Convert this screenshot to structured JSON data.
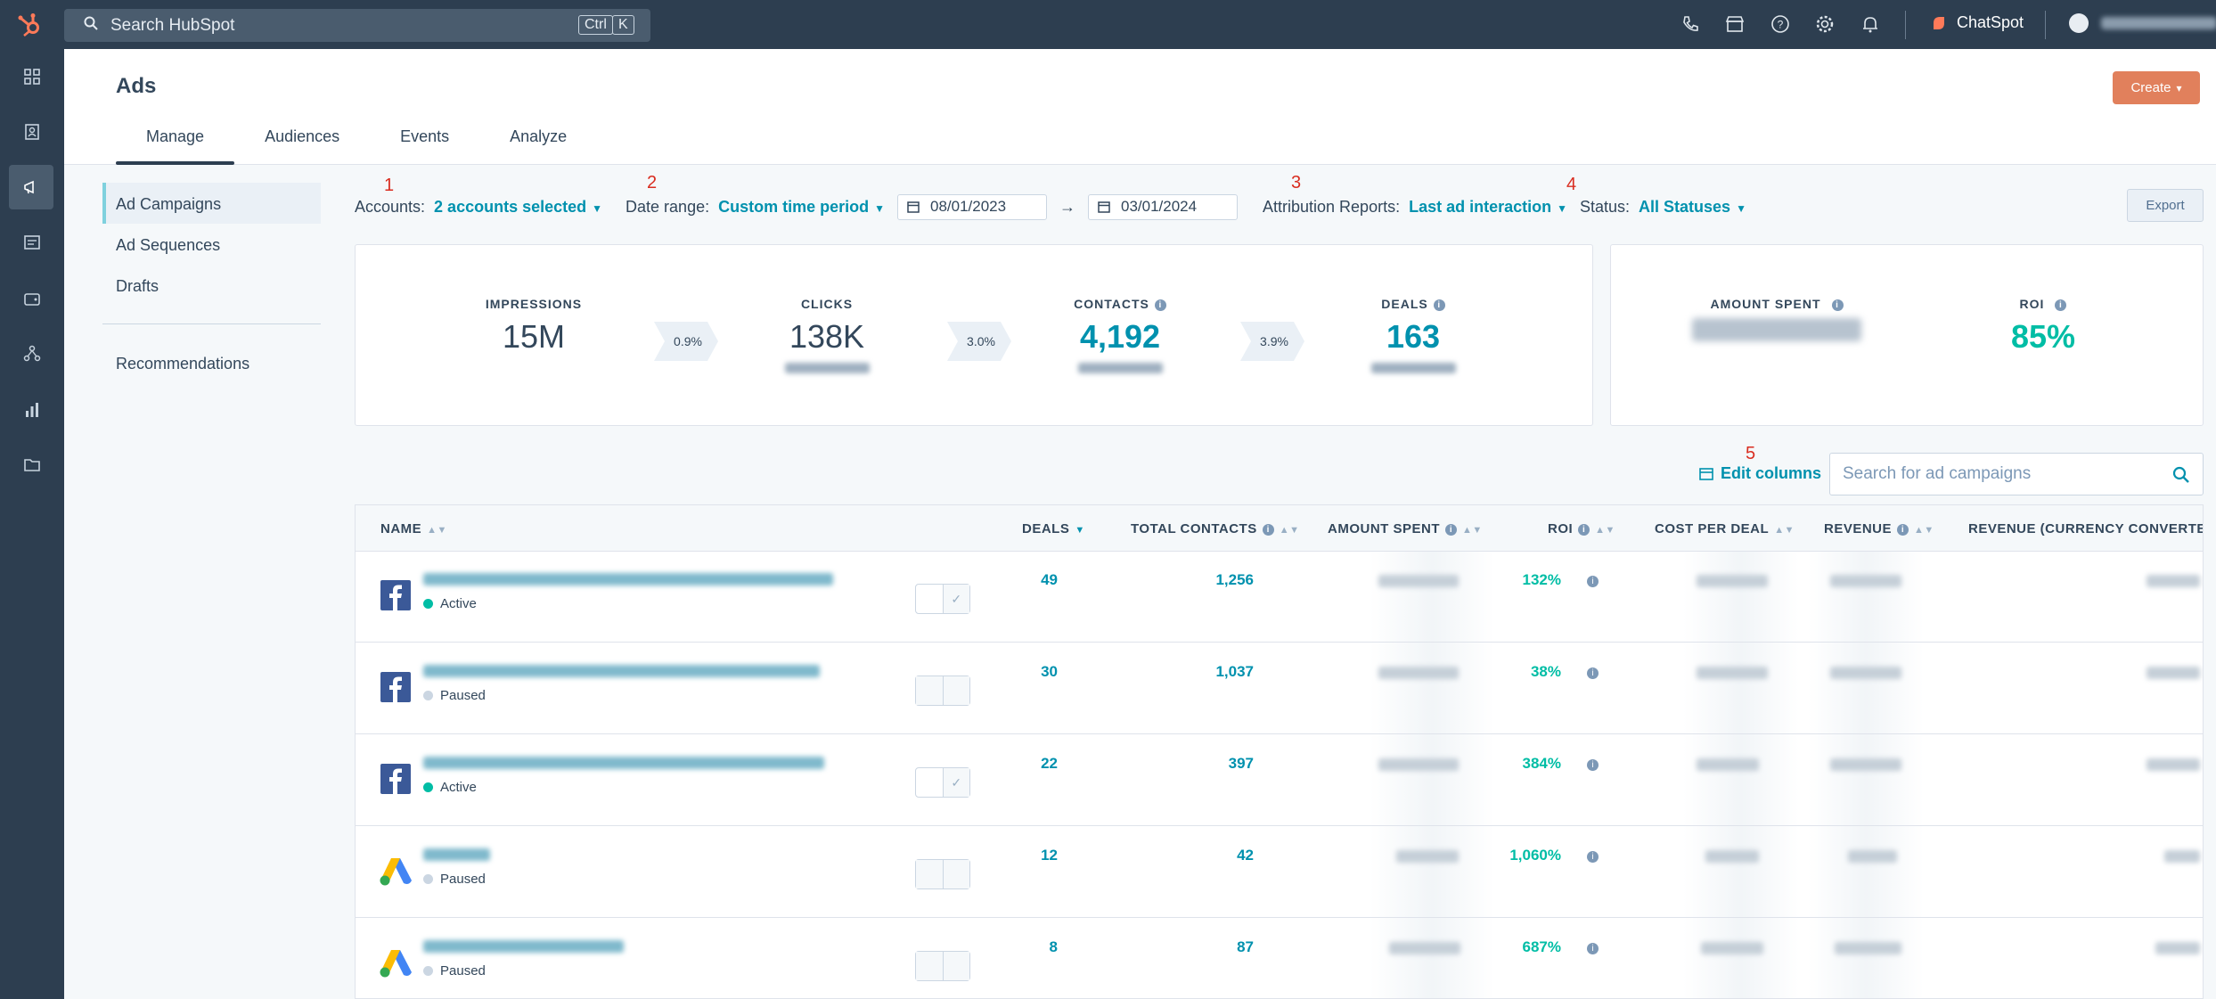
{
  "topbar": {
    "search_placeholder": "Search HubSpot",
    "kbd_ctrl": "Ctrl",
    "kbd_k": "K",
    "chatspot_label": "ChatSpot"
  },
  "header": {
    "title": "Ads",
    "create_label": "Create",
    "tabs": [
      {
        "label": "Manage"
      },
      {
        "label": "Audiences"
      },
      {
        "label": "Events"
      },
      {
        "label": "Analyze"
      }
    ]
  },
  "leftnav": {
    "items": [
      {
        "label": "Ad Campaigns"
      },
      {
        "label": "Ad Sequences"
      },
      {
        "label": "Drafts"
      },
      {
        "label": "Recommendations"
      }
    ]
  },
  "annotations": [
    "1",
    "2",
    "3",
    "4",
    "5"
  ],
  "filters": {
    "accounts_label": "Accounts:",
    "accounts_value": "2 accounts selected",
    "date_label": "Date range:",
    "date_value": "Custom time period",
    "start_date": "08/01/2023",
    "end_date": "03/01/2024",
    "attribution_label": "Attribution Reports:",
    "attribution_value": "Last ad interaction",
    "status_label": "Status:",
    "status_value": "All Statuses",
    "export_label": "Export"
  },
  "metrics": {
    "impressions": {
      "label": "IMPRESSIONS",
      "value": "15M"
    },
    "rate1": "0.9%",
    "clicks": {
      "label": "CLICKS",
      "value": "138K"
    },
    "rate2": "3.0%",
    "contacts": {
      "label": "CONTACTS",
      "value": "4,192"
    },
    "rate3": "3.9%",
    "deals": {
      "label": "DEALS",
      "value": "163"
    },
    "amount_spent": {
      "label": "AMOUNT SPENT"
    },
    "roi": {
      "label": "ROI",
      "value": "85%"
    }
  },
  "table": {
    "edit_columns_label": "Edit columns",
    "search_placeholder": "Search for ad campaigns",
    "columns": {
      "name": "NAME",
      "deals": "DEALS",
      "total_contacts": "TOTAL CONTACTS",
      "amount_spent": "AMOUNT SPENT",
      "roi": "ROI",
      "cost_per_deal": "COST PER DEAL",
      "revenue": "REVENUE",
      "revenue_converted": "REVENUE (CURRENCY CONVERTED)"
    },
    "rows": [
      {
        "network": "facebook",
        "status": "Active",
        "deals": "49",
        "contacts": "1,256",
        "roi": "132%"
      },
      {
        "network": "facebook",
        "status": "Paused",
        "deals": "30",
        "contacts": "1,037",
        "roi": "38%"
      },
      {
        "network": "facebook",
        "status": "Active",
        "deals": "22",
        "contacts": "397",
        "roi": "384%"
      },
      {
        "network": "google",
        "status": "Paused",
        "deals": "12",
        "contacts": "42",
        "roi": "1,060%"
      },
      {
        "network": "google",
        "status": "Paused",
        "deals": "8",
        "contacts": "87",
        "roi": "687%"
      }
    ]
  },
  "colors": {
    "topbar": "#2d3e50",
    "link": "#0091ae",
    "roi_green": "#00bda5",
    "create_button": "#e1805c",
    "status_active": "#00bda5",
    "status_paused": "#cbd6e2"
  }
}
